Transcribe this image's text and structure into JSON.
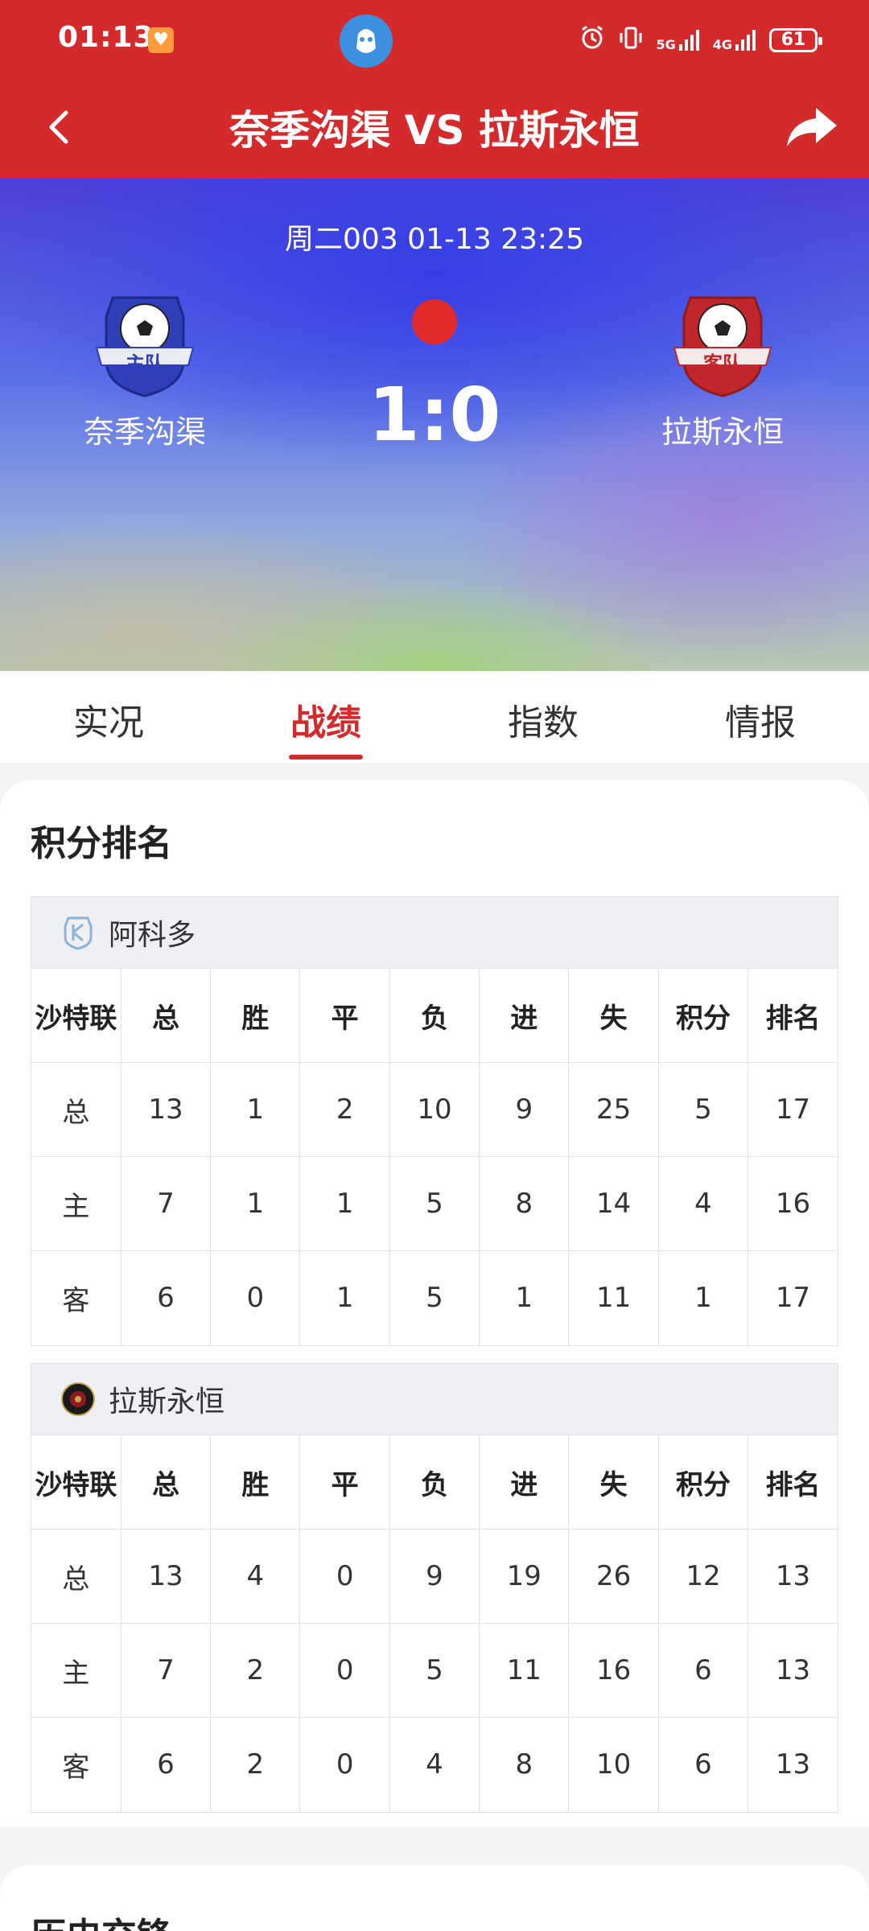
{
  "status_bar": {
    "time": "01:13",
    "network1": "5G",
    "network2": "4G",
    "battery": "61"
  },
  "header": {
    "title": "奈季沟渠 VS 拉斯永恒"
  },
  "match": {
    "info": "周二003 01-13 23:25",
    "score": "1:0",
    "home": {
      "name": "奈季沟渠",
      "badge_label": "主队"
    },
    "away": {
      "name": "拉斯永恒",
      "badge_label": "客队"
    }
  },
  "tabs": [
    {
      "label": "实况"
    },
    {
      "label": "战绩"
    },
    {
      "label": "指数"
    },
    {
      "label": "情报"
    }
  ],
  "standings": {
    "title": "积分排名",
    "columns": [
      "沙特联",
      "总",
      "胜",
      "平",
      "负",
      "进",
      "失",
      "积分",
      "排名"
    ],
    "teams": [
      {
        "name": "阿科多",
        "rows": [
          [
            "总",
            "13",
            "1",
            "2",
            "10",
            "9",
            "25",
            "5",
            "17"
          ],
          [
            "主",
            "7",
            "1",
            "1",
            "5",
            "8",
            "14",
            "4",
            "16"
          ],
          [
            "客",
            "6",
            "0",
            "1",
            "5",
            "1",
            "11",
            "1",
            "17"
          ]
        ]
      },
      {
        "name": "拉斯永恒",
        "rows": [
          [
            "总",
            "13",
            "4",
            "0",
            "9",
            "19",
            "26",
            "12",
            "13"
          ],
          [
            "主",
            "7",
            "2",
            "0",
            "5",
            "11",
            "16",
            "6",
            "13"
          ],
          [
            "客",
            "6",
            "2",
            "0",
            "4",
            "8",
            "10",
            "6",
            "13"
          ]
        ]
      }
    ]
  },
  "history": {
    "title": "历史交锋"
  },
  "colors": {
    "brand_red": "#d42a2b",
    "home_badge": "#2e3fb8",
    "away_badge": "#c0262a"
  }
}
